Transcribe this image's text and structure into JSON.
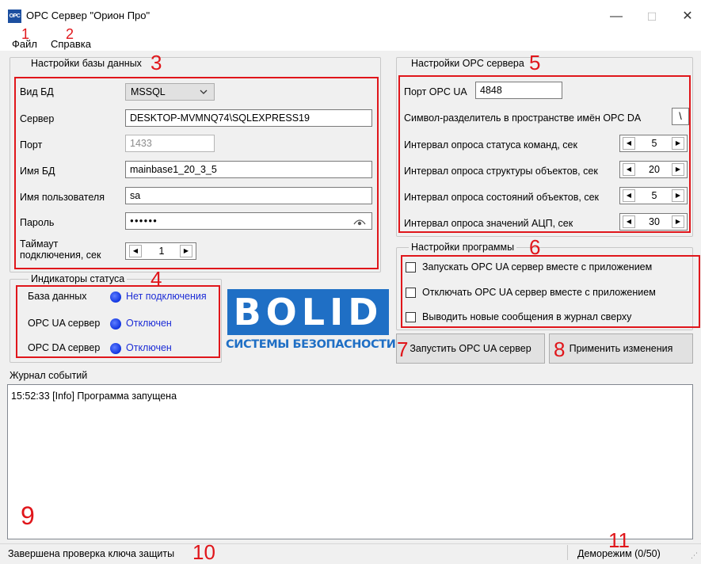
{
  "window": {
    "icon_text": "OPC",
    "title": "OPC Сервер \"Орион Про\"",
    "minimize": "—",
    "maximize": "☐",
    "close": "✕"
  },
  "menu": {
    "file": "Файл",
    "help": "Справка"
  },
  "annotations": [
    "1",
    "2",
    "3",
    "4",
    "5",
    "6",
    "7",
    "8",
    "9",
    "10",
    "11"
  ],
  "db_settings": {
    "title": "Настройки базы данных",
    "db_type_label": "Вид БД",
    "db_type_value": "MSSQL",
    "server_label": "Сервер",
    "server_value": "DESKTOP-MVMNQ74\\SQLEXPRESS19",
    "port_label": "Порт",
    "port_value": "1433",
    "db_name_label": "Имя БД",
    "db_name_value": "mainbase1_20_3_5",
    "user_label": "Имя пользователя",
    "user_value": "sa",
    "password_label": "Пароль",
    "password_value": "●●●●●●",
    "timeout_label_1": "Таймаут",
    "timeout_label_2": "подключения, сек",
    "timeout_value": "1"
  },
  "status": {
    "title": "Индикаторы статуса",
    "db_label": "База данных",
    "db_value": "Нет подключения",
    "ua_label": "OPC UA сервер",
    "ua_value": "Отключен",
    "da_label": "OPC DA сервер",
    "da_value": "Отключен"
  },
  "logo": {
    "text": "BOLID",
    "subtitle": "СИСТЕМЫ БЕЗОПАСНОСТИ",
    "color": "#1f6fc5"
  },
  "opc_settings": {
    "title": "Настройки OPC сервера",
    "ua_port_label": "Порт OPC UA",
    "ua_port_value": "4848",
    "separator_label": "Символ-разделитель в пространстве имён OPC DA",
    "separator_value": "\\",
    "cmd_interval_label": "Интервал опроса статуса команд, сек",
    "cmd_interval_value": "5",
    "struct_interval_label": "Интервал опроса структуры объектов, сек",
    "struct_interval_value": "20",
    "state_interval_label": "Интервал опроса состояний объектов, сек",
    "state_interval_value": "5",
    "adc_interval_label": "Интервал опроса значений АЦП, сек",
    "adc_interval_value": "30"
  },
  "program_settings": {
    "title": "Настройки программы",
    "opt1": "Запускать OPC UA сервер вместе с приложением",
    "opt2": "Отключать OPC UA сервер вместе с приложением",
    "opt3": "Выводить новые сообщения в журнал сверху"
  },
  "buttons": {
    "start": "Запустить OPC UA сервер",
    "apply": "Применить изменения"
  },
  "journal": {
    "title": "Журнал событий",
    "entries": [
      "15:52:33 [Info] Программа запущена"
    ]
  },
  "statusbar": {
    "left": "Завершена проверка ключа защиты",
    "right": "Деморежим (0/50)"
  },
  "colors": {
    "annotation": "#e0161b",
    "indicator": "#1034e0",
    "link": "#1d2dd6"
  }
}
